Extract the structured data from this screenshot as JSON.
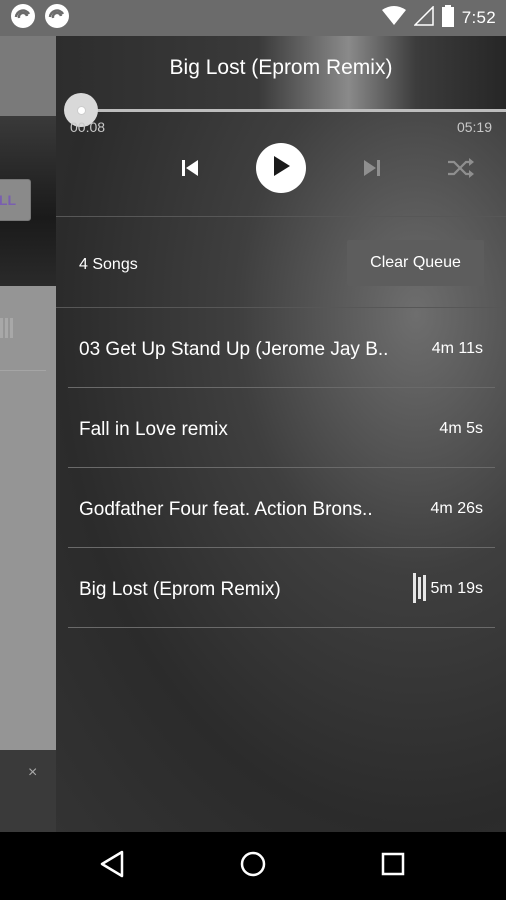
{
  "status_bar": {
    "time": "7:52"
  },
  "background_app": {
    "button_label": "LL",
    "close_glyph": "×"
  },
  "player": {
    "title": "Big Lost (Eprom Remix)",
    "elapsed": "00:08",
    "duration": "05:19",
    "progress": 0.025
  },
  "queue": {
    "count_label": "4 Songs",
    "clear_label": "Clear Queue",
    "items": [
      {
        "title": "03 Get Up Stand Up (Jerome Jay B..",
        "duration": "4m 11s"
      },
      {
        "title": "Fall in Love remix",
        "duration": "4m 5s"
      },
      {
        "title": "Godfather Four feat. Action Brons..",
        "duration": "4m 26s"
      },
      {
        "title": "Big Lost (Eprom Remix)",
        "duration": "5m 19s",
        "now_playing": true
      }
    ]
  },
  "icons": [
    "app-logo-icon",
    "wifi-icon",
    "signal-icon",
    "battery-icon",
    "previous-icon",
    "play-icon",
    "next-icon",
    "shuffle-icon",
    "equalizer-icon",
    "back-nav-icon",
    "home-nav-icon",
    "recents-nav-icon"
  ],
  "colors": {
    "accent": "#7a5fb0",
    "primary_text": "#ffffff",
    "secondary_text": "#c8c8c8"
  }
}
